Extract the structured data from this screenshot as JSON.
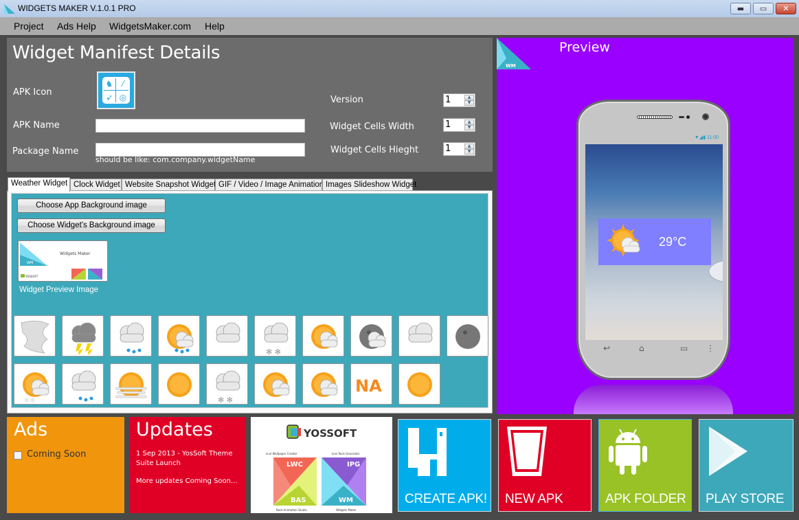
{
  "window": {
    "title": "WIDGETS MAKER V.1.0.1 PRO",
    "buttons": [
      "minimize",
      "maximize",
      "close"
    ]
  },
  "menu": [
    "Project",
    "Ads Help",
    "WidgetsMaker.com",
    "Help"
  ],
  "manifest": {
    "heading": "Widget Manifest Details",
    "apk_icon_label": "APK Icon",
    "apk_name_label": "APK Name",
    "apk_name_value": "",
    "package_name_label": "Package Name",
    "package_name_value": "",
    "package_hint": "should be like: com.company.widgetName",
    "version_label": "Version",
    "version_value": "1",
    "cells_width_label": "Widget Cells Width",
    "cells_width_value": "1",
    "cells_height_label": "Widget Cells Hieght",
    "cells_height_value": "1"
  },
  "tabs": [
    {
      "label": "Weather Widget",
      "active": true
    },
    {
      "label": "Clock Widget",
      "active": false
    },
    {
      "label": "Website Snapshot Widget",
      "active": false
    },
    {
      "label": "GIF / Video / Image Animation",
      "active": false
    },
    {
      "label": "Images Slideshow Widget",
      "active": false
    }
  ],
  "weather_tab": {
    "choose_app_bg": "Choose App Background image",
    "choose_widget_bg": "Choose Widget's Background image",
    "preview_thumb_text": "Widgets Maker",
    "preview_thumb_wm": "WM",
    "preview_thumb_brand": "YOSSOFT",
    "preview_caption": "Widget Preview Image",
    "icons": [
      "fog-icon",
      "thunderstorm-icon",
      "rain-icon",
      "sun-rain-icon",
      "cloudy-icon",
      "snow-cloud-icon",
      "partly-sunny-icon",
      "moon-cloud-icon",
      "overcast-icon",
      "moon-icon",
      "sun-snow-icon",
      "sleet-icon",
      "haze-icon",
      "sunny-icon",
      "night-snow-icon",
      "sun-cloud-icon",
      "mostly-sunny-icon",
      "not-available-icon",
      "hot-sun-icon"
    ],
    "na_text": "NA"
  },
  "preview": {
    "title": "Preview",
    "wm_badge": "WM",
    "status_time": "11:00",
    "temperature": "29°C"
  },
  "tiles": {
    "ads": {
      "heading": "Ads",
      "checkbox_label": "Coming Soon",
      "checked": false
    },
    "updates": {
      "heading": "Updates",
      "line1": "1 Sep 2013 - YosSoft Theme",
      "line2": "Suite Launch",
      "line3": "More updates Coming Soon..."
    },
    "yossoft": {
      "brand": "YOSSOFT",
      "products": [
        {
          "code": "LWC",
          "name": "Live Wallpaper Creator"
        },
        {
          "code": "IPG",
          "name": "Icon Pack Generator"
        },
        {
          "code": "BAS",
          "name": "Boot Animation Studio"
        },
        {
          "code": "WM",
          "name": "Widgets Maker"
        }
      ]
    }
  },
  "actions": [
    {
      "label": "CREATE APK!",
      "color": "#00adea"
    },
    {
      "label": "NEW APK",
      "color": "#e00025"
    },
    {
      "label": "APK FOLDER",
      "color": "#99c226"
    },
    {
      "label": "PLAY STORE",
      "color": "#3da8b9"
    }
  ]
}
